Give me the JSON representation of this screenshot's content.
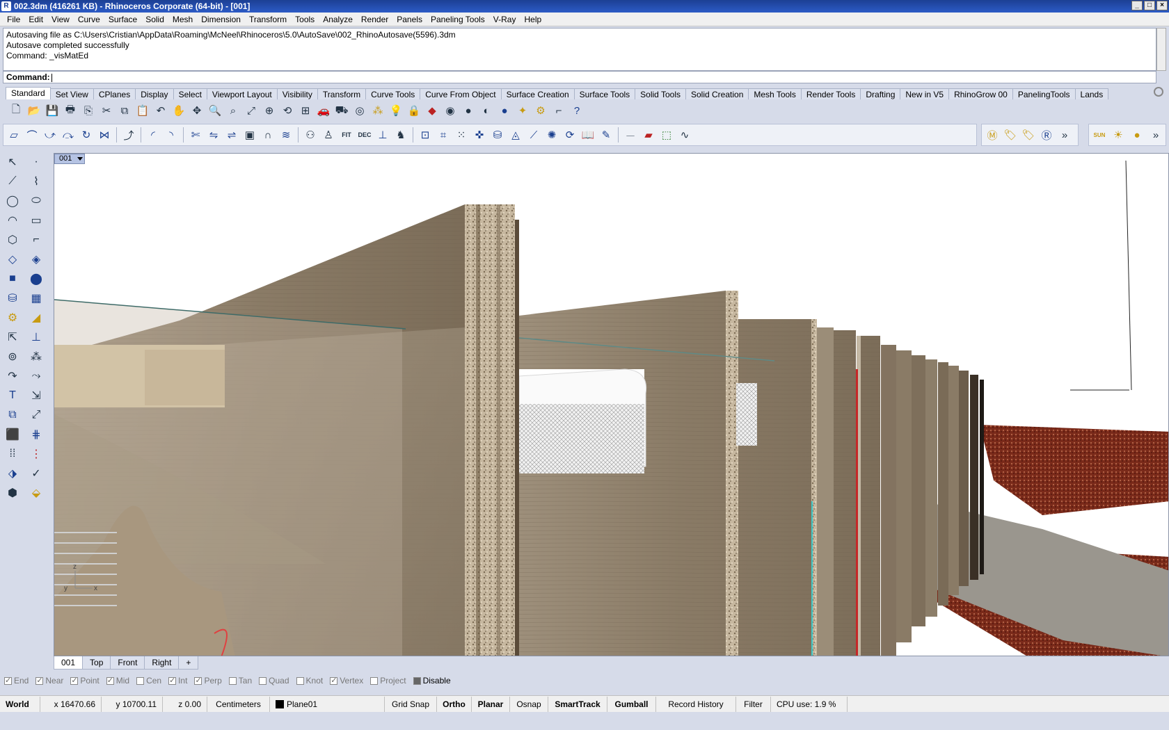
{
  "window": {
    "title": "002.3dm (416261 KB) - Rhinoceros Corporate (64-bit) - [001]",
    "controls": [
      "_",
      "□",
      "×"
    ]
  },
  "menu": [
    "File",
    "Edit",
    "View",
    "Curve",
    "Surface",
    "Solid",
    "Mesh",
    "Dimension",
    "Transform",
    "Tools",
    "Analyze",
    "Render",
    "Panels",
    "Paneling Tools",
    "V-Ray",
    "Help"
  ],
  "command_history": {
    "lines": [
      "Autosaving file as C:\\Users\\Cristian\\AppData\\Roaming\\McNeel\\Rhinoceros\\5.0\\AutoSave\\002_RhinoAutosave(5596).3dm",
      "Autosave completed successfully",
      "Command: _visMatEd"
    ]
  },
  "command_prompt": {
    "label": "Command:",
    "value": ""
  },
  "toolbar_tabs": [
    "Standard",
    "Set View",
    "CPlanes",
    "Display",
    "Select",
    "Viewport Layout",
    "Visibility",
    "Transform",
    "Curve Tools",
    "Curve From Object",
    "Surface Creation",
    "Surface Tools",
    "Solid Tools",
    "Solid Creation",
    "Mesh Tools",
    "Render Tools",
    "Drafting",
    "New in V5",
    "RhinoGrow 00",
    "PanelingTools",
    "Lands"
  ],
  "toolbar_row2_text": {
    "fit": "FIT",
    "dec": "DEC",
    "sun": "SUN"
  },
  "viewport": {
    "name": "001",
    "axis_labels": {
      "x": "x",
      "y": "y",
      "z": "z"
    }
  },
  "viewport_tabs": [
    "001",
    "Top",
    "Front",
    "Right",
    "+"
  ],
  "osnaps": [
    {
      "label": "End",
      "checked": true
    },
    {
      "label": "Near",
      "checked": true
    },
    {
      "label": "Point",
      "checked": true
    },
    {
      "label": "Mid",
      "checked": true
    },
    {
      "label": "Cen",
      "checked": false
    },
    {
      "label": "Int",
      "checked": true
    },
    {
      "label": "Perp",
      "checked": true
    },
    {
      "label": "Tan",
      "checked": false
    },
    {
      "label": "Quad",
      "checked": false
    },
    {
      "label": "Knot",
      "checked": false
    },
    {
      "label": "Vertex",
      "checked": true
    },
    {
      "label": "Project",
      "checked": false
    },
    {
      "label": "Disable",
      "checked": false
    }
  ],
  "status": {
    "cplane": "World",
    "x": "x 16470.66",
    "y": "y 10700.11",
    "z": "z 0.00",
    "units": "Centimeters",
    "layer": "Plane01",
    "grid_snap": "Grid Snap",
    "ortho": "Ortho",
    "planar": "Planar",
    "osnap": "Osnap",
    "smarttrack": "SmartTrack",
    "gumball": "Gumball",
    "record_history": "Record History",
    "filter": "Filter",
    "cpu": "CPU use: 1.9 %"
  },
  "colors": {
    "title_bar": "#2c5bc6",
    "wood": "#8c7b66",
    "gravel": "#7a2a1a"
  }
}
